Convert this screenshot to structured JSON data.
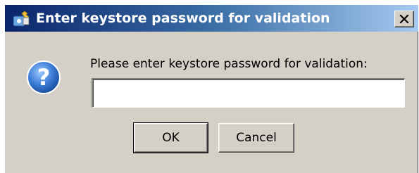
{
  "window": {
    "title": "Enter keystore password for validation",
    "app_icon": "keystore-app-icon",
    "close_icon": "close-icon"
  },
  "dialog": {
    "icon": "question-icon",
    "prompt": "Please enter keystore password for validation:",
    "password_value": "",
    "ok_label": "OK",
    "cancel_label": "Cancel"
  },
  "colors": {
    "titlebar_start": "#0a246a",
    "titlebar_end": "#a6caf0",
    "dialog_bg": "#d4d0c8",
    "question_icon": "#3a7bd5"
  }
}
